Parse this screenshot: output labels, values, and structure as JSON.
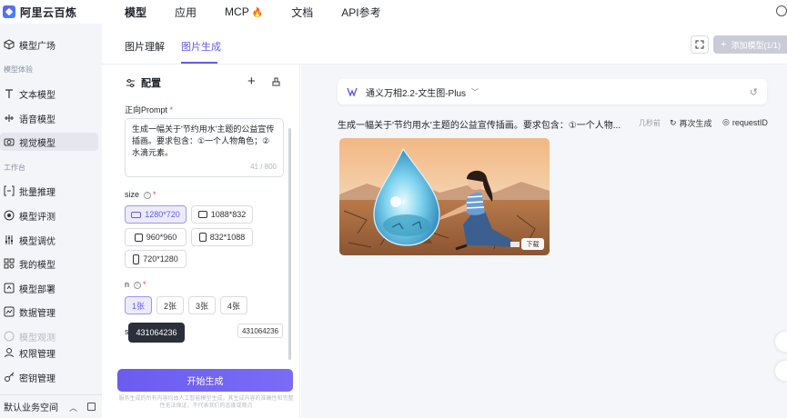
{
  "app": {
    "logo_text": "阿里云百炼",
    "brand_color": "#615ced"
  },
  "topnav": [
    {
      "label": "模型"
    },
    {
      "label": "应用"
    },
    {
      "label": "MCP"
    },
    {
      "label": "文档"
    },
    {
      "label": "API参考"
    }
  ],
  "sidebar": {
    "model_square": "模型广场",
    "section_experience": "模型体验",
    "text_model": "文本模型",
    "voice_model": "语音模型",
    "vision_model": "视觉模型",
    "section_workbench": "工作台",
    "batch_inference": "批量推理",
    "model_eval": "模型评测",
    "model_tune": "模型调优",
    "my_models": "我的模型",
    "model_deploy": "模型部署",
    "data_manage": "数据管理",
    "model_monitor": "模型观测",
    "permission": "权限管理",
    "key_manage": "密钥管理",
    "workspace": "默认业务空间"
  },
  "tabs": {
    "image_understanding": "图片理解",
    "image_generation": "图片生成",
    "add_model": "添加模型(1/1)"
  },
  "config": {
    "title": "配置",
    "prompt_label": "正向Prompt",
    "prompt_value": "生成一幅关于'节约用水'主题的公益宣传插画。要求包含：①一个人物角色；②水滴元素。",
    "prompt_count": "41 / 800",
    "size_label": "size",
    "sizes": [
      "1280*720",
      "1088*832",
      "960*960",
      "832*1088",
      "720*1280"
    ],
    "n_label": "n",
    "n_options": [
      "1张",
      "2张",
      "3张",
      "4张"
    ],
    "seed_label": "s",
    "seed_tooltip": "431064236",
    "seed_value": "431064236",
    "generate_button": "开始生成",
    "disclaimer": "服务生成的所有内容均由人工智能模型生成，其生成内容的准确性和完整性无法保证，不代表我们的态度或观点"
  },
  "result": {
    "model_name": "通义万相2.2-文生图-Plus",
    "prompt": "生成一幅关于'节约用水'主题的公益宣传插画。要求包含：①一个人物...",
    "time": "几秒前",
    "regenerate": "再次生成",
    "request_id": "requestID",
    "download": "下载"
  }
}
